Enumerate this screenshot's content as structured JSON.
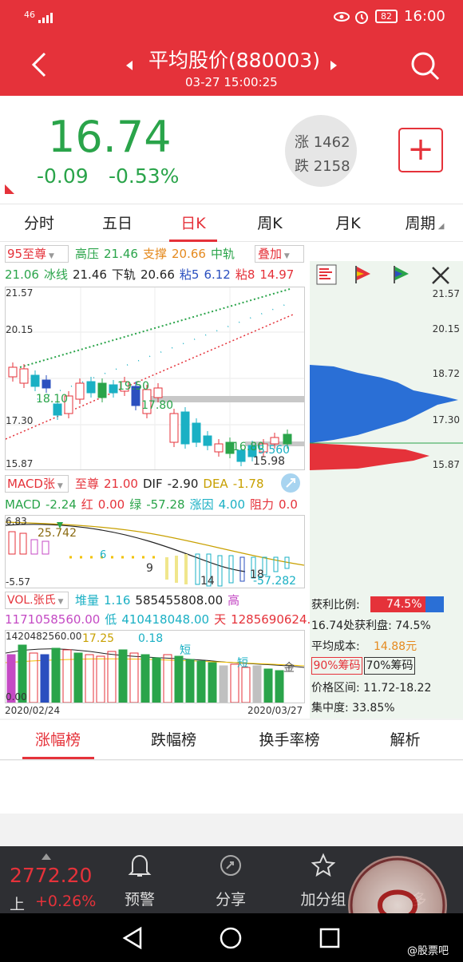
{
  "status": {
    "signal": "46",
    "battery": "82",
    "time": "16:00"
  },
  "header": {
    "title": "平均股价(880003)",
    "datetime": "03-27 15:00:25"
  },
  "quote": {
    "price": "16.74",
    "change": "-0.09",
    "change_pct": "-0.53%",
    "up_label": "涨 1462",
    "down_label": "跌 2158",
    "add_label": "+"
  },
  "tabs": [
    "分时",
    "五日",
    "日K",
    "周K",
    "月K",
    "周期"
  ],
  "indicator": {
    "selector": "95至尊",
    "overlay": "叠加",
    "line1": [
      {
        "t": "高压",
        "c": "#2aa44a"
      },
      {
        "t": "21.46",
        "c": "#2aa44a"
      },
      {
        "t": "支撑",
        "c": "#e58a1f"
      },
      {
        "t": "20.66",
        "c": "#e58a1f"
      },
      {
        "t": "中轨",
        "c": "#2aa44a"
      }
    ],
    "line2": [
      {
        "t": "21.06",
        "c": "#2aa44a"
      },
      {
        "t": "冰线",
        "c": "#2aa44a"
      },
      {
        "t": "21.46",
        "c": "#222"
      },
      {
        "t": "下轨",
        "c": "#222"
      },
      {
        "t": "20.66",
        "c": "#222"
      },
      {
        "t": "粘5",
        "c": "#2a4fbf"
      },
      {
        "t": "6.12",
        "c": "#2a4fbf"
      },
      {
        "t": "粘8",
        "c": "#e5323a"
      },
      {
        "t": "14.97",
        "c": "#e5323a"
      }
    ]
  },
  "price_axis": {
    "top": "21.57",
    "upper": "20.15",
    "lower": "17.30",
    "bottom": "15.87",
    "right_mid": "18.72"
  },
  "price_annotations": {
    "a": "18.10",
    "b": "19.50",
    "c": "17.80",
    "d": "16.80",
    "e": "15.98",
    "f": "5.560"
  },
  "macd": {
    "selector": "MACD张",
    "line1": [
      {
        "t": "至尊",
        "c": "#e5323a"
      },
      {
        "t": "21.00",
        "c": "#e5323a"
      },
      {
        "t": "DIF",
        "c": "#222"
      },
      {
        "t": "-2.90",
        "c": "#222"
      },
      {
        "t": "DEA",
        "c": "#c8a000"
      },
      {
        "t": "-1.78",
        "c": "#c8a000"
      }
    ],
    "line2": [
      {
        "t": "MACD",
        "c": "#2aa44a"
      },
      {
        "t": "-2.24",
        "c": "#2aa44a"
      },
      {
        "t": "红",
        "c": "#e5323a"
      },
      {
        "t": "0.00",
        "c": "#e5323a"
      },
      {
        "t": "绿",
        "c": "#2aa44a"
      },
      {
        "t": "-57.28",
        "c": "#2aa44a"
      },
      {
        "t": "涨因",
        "c": "#1ab0c4"
      },
      {
        "t": "4.00",
        "c": "#1ab0c4"
      },
      {
        "t": "阻力",
        "c": "#e5323a"
      },
      {
        "t": "0.0",
        "c": "#e5323a"
      }
    ],
    "axis_top": "6.83",
    "axis_bottom": "-5.57",
    "ann1": "25.742",
    "ann2": "9",
    "ann3": "14",
    "ann4": "18",
    "ann5": "-57.282",
    "ann6": "6"
  },
  "vol": {
    "selector": "VOL.张氏",
    "line1": [
      {
        "t": "堆量",
        "c": "#1ab0c4"
      },
      {
        "t": "1.16",
        "c": "#1ab0c4"
      },
      {
        "t": "585455808.00",
        "c": "#222"
      },
      {
        "t": "高",
        "c": "#c44ac4"
      }
    ],
    "line2": [
      {
        "t": "1171058560.00",
        "c": "#c44ac4"
      },
      {
        "t": "低",
        "c": "#1ab0c4"
      },
      {
        "t": "410418048.00",
        "c": "#1ab0c4"
      },
      {
        "t": "天",
        "c": "#e5323a"
      },
      {
        "t": "1285690624.",
        "c": "#e5323a"
      }
    ],
    "axis_top": "1420482560.00",
    "axis_bottom": "0.00",
    "ann_a": "17.25",
    "ann_b": "0.18",
    "ann_c": "短",
    "ann_d": "短",
    "ann_e": "金",
    "date_start": "2020/02/24",
    "date_end": "2020/03/27"
  },
  "chip": {
    "profit_label": "获利比例:",
    "profit_value": "74.5%",
    "line2": "16.74处获利盘: 74.5%",
    "line3_label": "平均成本:",
    "line3_value": "14.88元",
    "btn90": "90%筹码",
    "btn70": "70%筹码",
    "range": "价格区间: 11.72-18.22",
    "concentration": "集中度: 33.85%"
  },
  "bottom_tabs": [
    "涨幅榜",
    "跌幅榜",
    "换手率榜",
    "解析"
  ],
  "navbar": {
    "index_value": "2772.20",
    "index_name": "上",
    "index_change": "+0.26%",
    "items": [
      "预警",
      "分享",
      "加分组",
      "多"
    ]
  },
  "watermark": "@股票吧",
  "colors": {
    "red": "#e5323a",
    "green": "#2aa44a",
    "blue": "#2a6fd6"
  }
}
